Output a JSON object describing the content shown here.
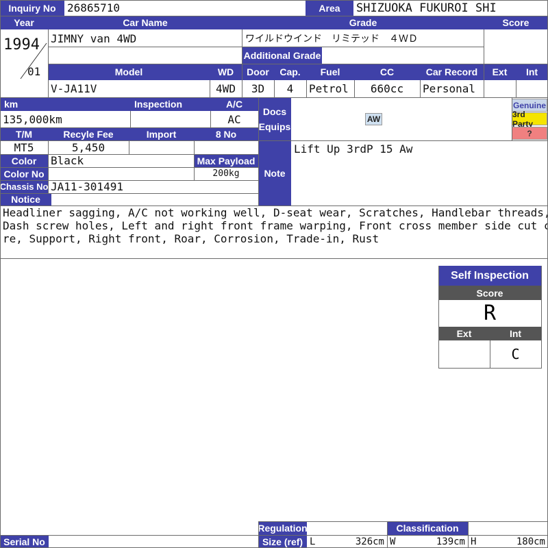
{
  "header": {
    "inquiry_label": "Inquiry No",
    "inquiry_value": "26865710",
    "area_label": "Area",
    "area_value": "SHIZUOKA FUKUROI SHI"
  },
  "labels": {
    "year": "Year",
    "car_name": "Car Name",
    "grade": "Grade",
    "score": "Score",
    "additional_grade": "Additional Grade",
    "model": "Model",
    "wd": "WD",
    "door": "Door",
    "cap": "Cap.",
    "fuel": "Fuel",
    "cc": "CC",
    "car_record": "Car Record",
    "ext": "Ext",
    "int": "Int",
    "km": "km",
    "inspection": "Inspection",
    "ac": "A/C",
    "docs": "Docs",
    "equips": "Equips",
    "tm": "T/M",
    "recycle_fee": "Recyle Fee",
    "import": "Import",
    "eight_no": "8 No",
    "color": "Color",
    "max_payload": "Max Payload",
    "color_no": "Color No",
    "note": "Note",
    "chassis_no": "Chassis No",
    "notice": "Notice",
    "serial_no": "Serial No",
    "regulation": "Regulation",
    "size_ref": "Size (ref)",
    "classification": "Classification",
    "size_l": "L",
    "size_w": "W",
    "size_h": "H"
  },
  "vehicle": {
    "year": "1994",
    "month": "01",
    "car_name": "JIMNY van 4WD",
    "grade": "ワイルドウインド　リミテッド　４ＷＤ",
    "additional_grade": "",
    "model": "V-JA11V",
    "wd": "4WD",
    "door": "3D",
    "cap": "4",
    "fuel": "Petrol",
    "cc": "660cc",
    "car_record": "Personal",
    "km": "135,000km",
    "inspection": "",
    "ac": "AC",
    "tm": "MT5",
    "recycle_fee": "5,450",
    "import": "",
    "eight_no": "",
    "color": "Black",
    "max_payload": "200kg",
    "color_no": "",
    "chassis_no": "JA11-301491",
    "note": "Lift Up 3rdP 15 Aw",
    "equip_badge": "AW",
    "notice_lines": [
      "Headliner sagging, A/C not working well, D-seat wear, Scratches, Handlebar threads,",
      "Dash screw holes, Left and right front frame warping, Front cross member side cut co",
      "re, Support, Right front, Roar, Corrosion, Trade-in, Rust"
    ],
    "serial_no": "",
    "size_l": "326cm",
    "size_w": "139cm",
    "size_h": "180cm"
  },
  "legend": {
    "genuine": "Genuine",
    "third_party": "3rd Party",
    "unknown": "?"
  },
  "self_inspection": {
    "title": "Self Inspection",
    "score_label": "Score",
    "score": "R",
    "ext_label": "Ext",
    "int_label": "Int",
    "ext": "",
    "int": "C"
  },
  "colors": {
    "header_blue": "#3f41a8",
    "genuine_bg": "#c9d6ea",
    "third_party_bg": "#f5e400",
    "unknown_bg": "#f08080",
    "badge_bg": "#cfe0f0"
  }
}
